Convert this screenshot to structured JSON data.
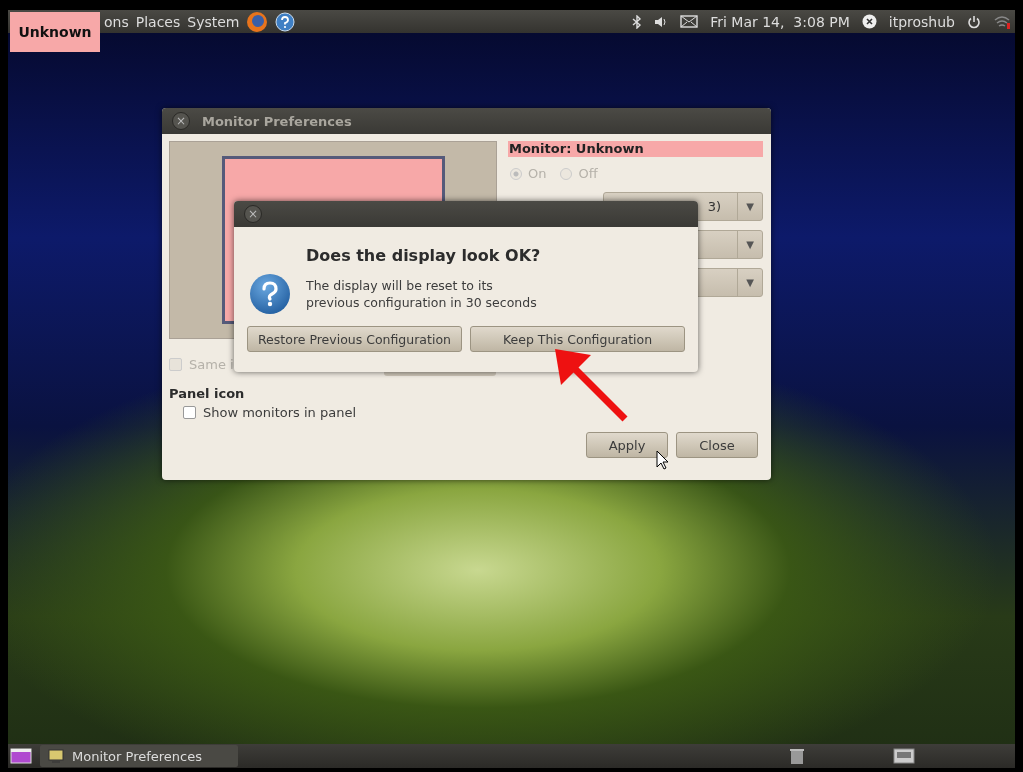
{
  "top_panel": {
    "menus": [
      "ons",
      "Places",
      "System"
    ],
    "clock": "Fri Mar 14,  3:08 PM",
    "user": "itproshub"
  },
  "overlay_label": {
    "text": "Unknown"
  },
  "monitor_window": {
    "title": "Monitor Preferences",
    "close_glyph": "×",
    "monitor_label": "Monitor: Unknown",
    "power_options": [
      {
        "label": "On",
        "selected": true
      },
      {
        "label": "Off",
        "selected": false
      }
    ],
    "dropdowns": [
      {
        "text": "3)",
        "arrow": "▼"
      },
      {
        "arrow": "▼"
      },
      {
        "arrow": "▼"
      }
    ],
    "same_image": {
      "label": "Same i",
      "checked": false
    },
    "panel_icon_heading": "Panel icon",
    "show_monitors": {
      "label": "Show monitors in panel",
      "checked": false
    },
    "buttons": [
      "Apply",
      "Close"
    ]
  },
  "dialog": {
    "close_glyph": "×",
    "heading": "Does the display look OK?",
    "message_lines": [
      "The display will be reset to its",
      "previous configuration in 30 seconds"
    ],
    "buttons": [
      "Restore Previous Configuration",
      "Keep This Configuration"
    ]
  },
  "taskbar": {
    "tasks": [
      {
        "label": "Monitor Preferences"
      }
    ]
  }
}
